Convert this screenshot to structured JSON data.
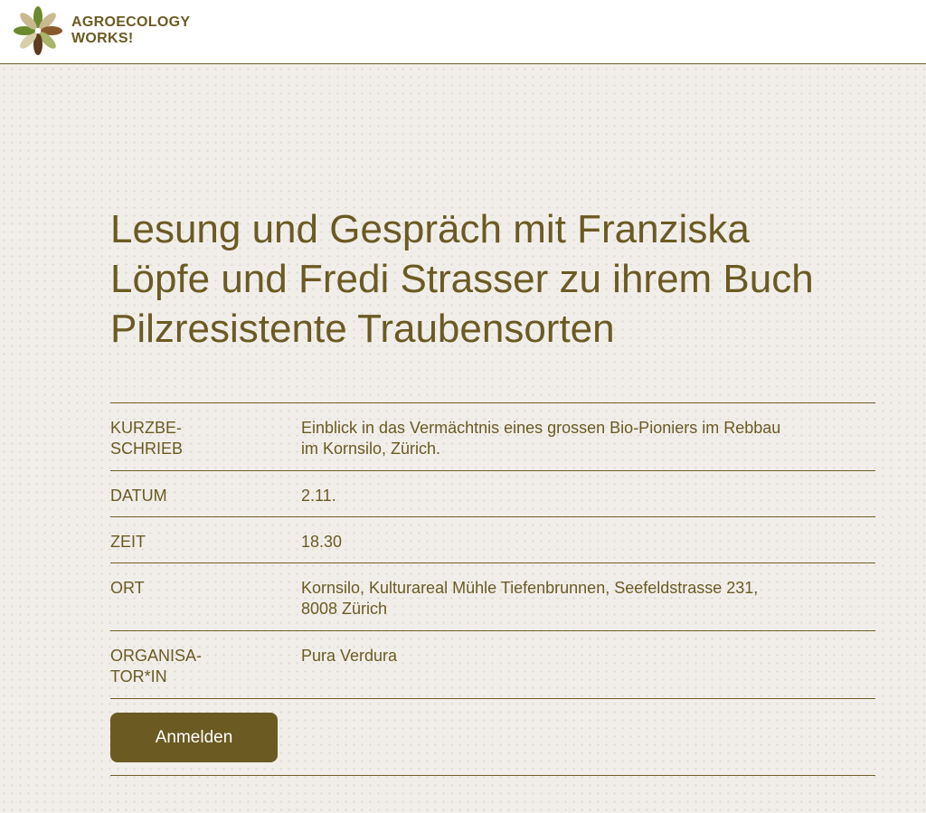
{
  "header": {
    "logo_line1": "AGROECOLOGY",
    "logo_line2": "WORKS!",
    "logo_colors": [
      "#6b8a2e",
      "#c9b98f",
      "#8a5a2b",
      "#a8b56a",
      "#5e3b1e",
      "#d8cfa8"
    ]
  },
  "event": {
    "title": "Lesung und Gespräch mit Franziska Löpfe und Fredi Strasser zu ihrem Buch Pilzresistente Traubensorten",
    "details": [
      {
        "label": "KURZBE-\nSCHRIEB",
        "value": "Einblick in das Vermächtnis eines grossen Bio-Pioniers im Rebbau\nim Kornsilo, Zürich."
      },
      {
        "label": "DATUM",
        "value": "2.11."
      },
      {
        "label": "ZEIT",
        "value": "18.30"
      },
      {
        "label": "ORT",
        "value": "Kornsilo, Kulturareal Mühle Tiefenbrunnen, Seefeldstrasse 231,\n8008 Zürich"
      },
      {
        "label": "ORGANISA-\nTOR*IN",
        "value": "Pura Verdura"
      }
    ],
    "register_label": "Anmelden"
  },
  "theme": {
    "accent": "#6b5a22",
    "background": "#f1eeea"
  }
}
